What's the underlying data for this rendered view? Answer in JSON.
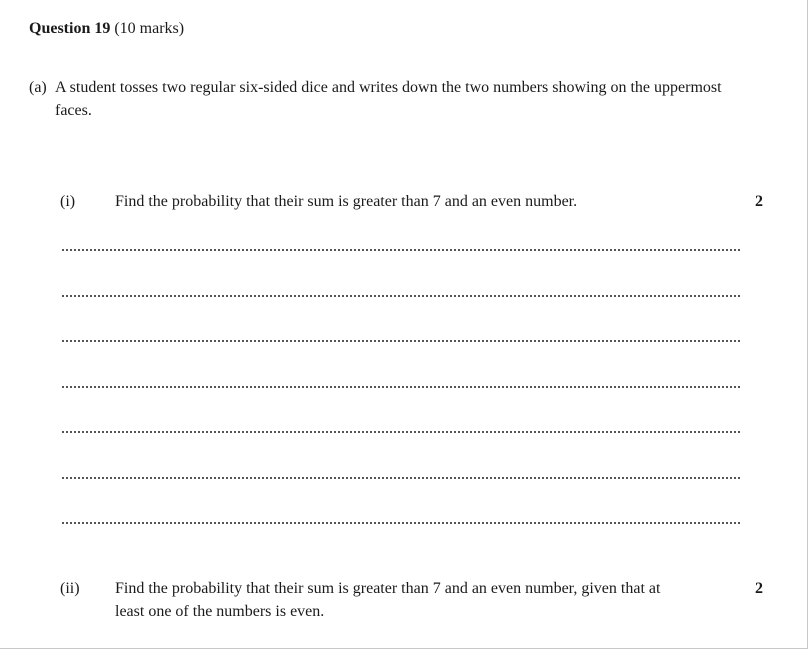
{
  "question": {
    "title": "Question 19",
    "marks": "(10 marks)"
  },
  "part_a": {
    "label": "(a)",
    "text": "A student tosses two regular six-sided dice and writes down the two numbers showing on the uppermost faces."
  },
  "sub_i": {
    "label": "(i)",
    "text": "Find the probability that their sum is greater than 7 and an even number.",
    "marks": "2"
  },
  "sub_ii": {
    "label": "(ii)",
    "text": "Find the probability that their sum is greater than 7 and an even number, given that at least one of the numbers is even.",
    "marks": "2"
  },
  "answer_lines": 7
}
